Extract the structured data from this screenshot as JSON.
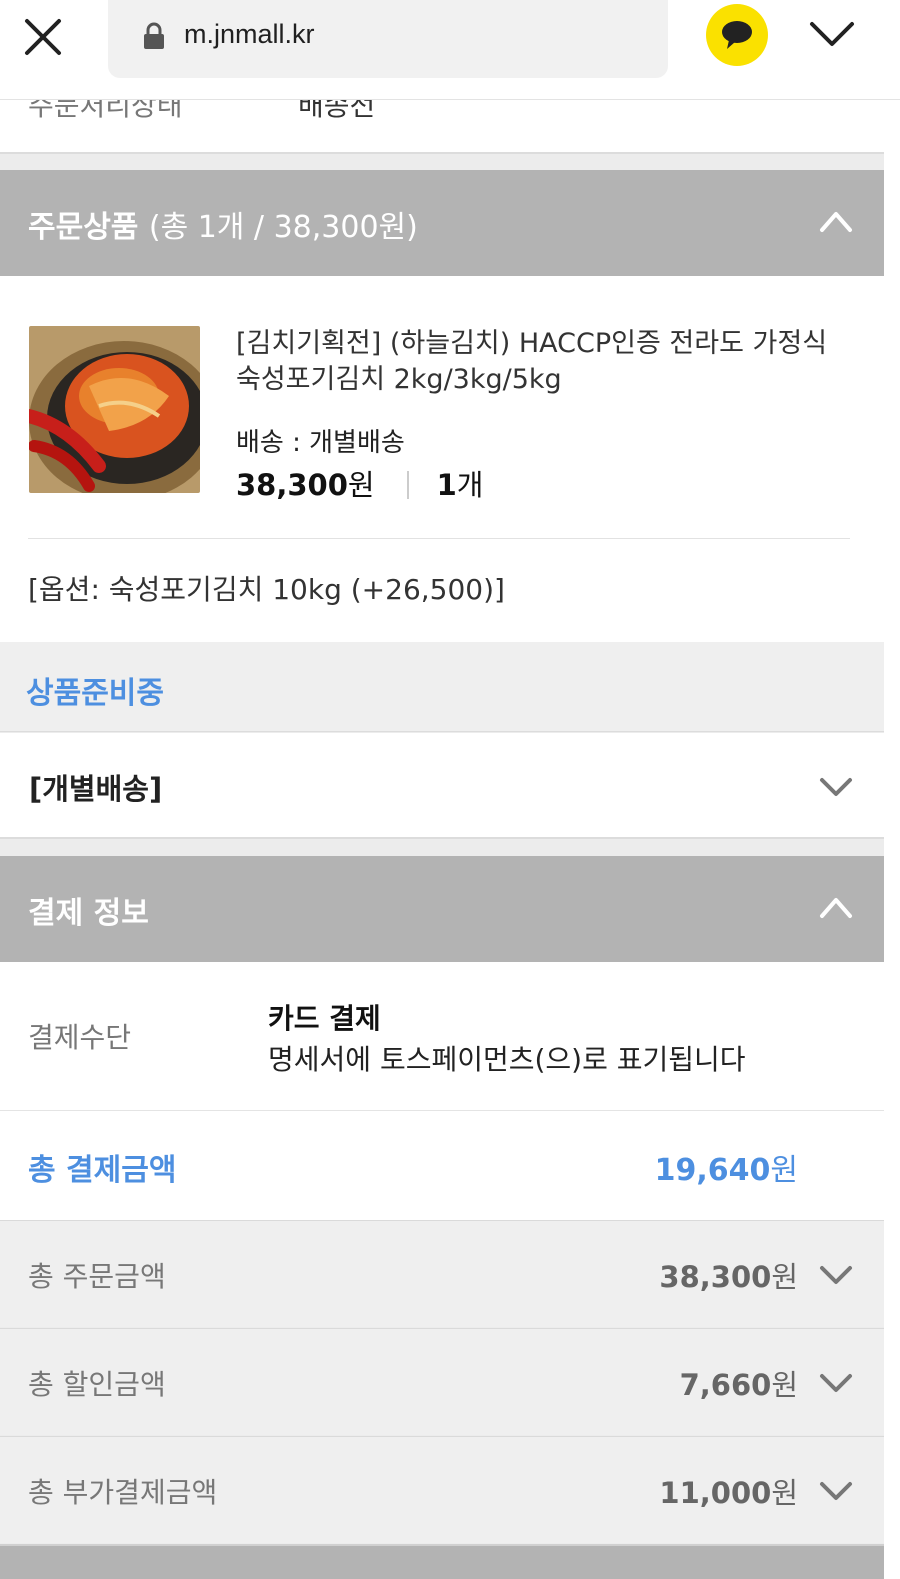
{
  "browser": {
    "url": "m.jnmall.kr"
  },
  "order_status": {
    "label": "주문처리상태",
    "value": "배송전"
  },
  "order_items_section": {
    "title": "주문상품",
    "summary": "(총 1개 / 38,300원)"
  },
  "product": {
    "name": "[김치기획전] (하늘김치) HACCP인증 전라도 가정식 숙성포기김치 2kg/3kg/5kg",
    "shipping": "배송 : 개별배송",
    "price": "38,300",
    "price_unit": "원",
    "quantity": "1",
    "quantity_unit": "개",
    "option": "[옵션: 숙성포기김치 10kg (+26,500)]"
  },
  "item_state": "상품준비중",
  "shipping_group": "[개별배송]",
  "payment_section": {
    "title": "결제 정보",
    "method_label": "결제수단",
    "method_title": "카드 결제",
    "method_note": "명세서에 토스페이먼츠(으)로 표기됩니다",
    "total_label": "총 결제금액",
    "total_value": "19,640",
    "total_unit": "원"
  },
  "summary_rows": [
    {
      "label": "총 주문금액",
      "value": "38,300",
      "unit": "원"
    },
    {
      "label": "총 할인금액",
      "value": "7,660",
      "unit": "원"
    },
    {
      "label": "총 부가결제금액",
      "value": "11,000",
      "unit": "원"
    }
  ],
  "colors": {
    "accent_blue": "#4d8fe0",
    "header_gray": "#b3b3b3",
    "kakao_yellow": "#fae100"
  }
}
